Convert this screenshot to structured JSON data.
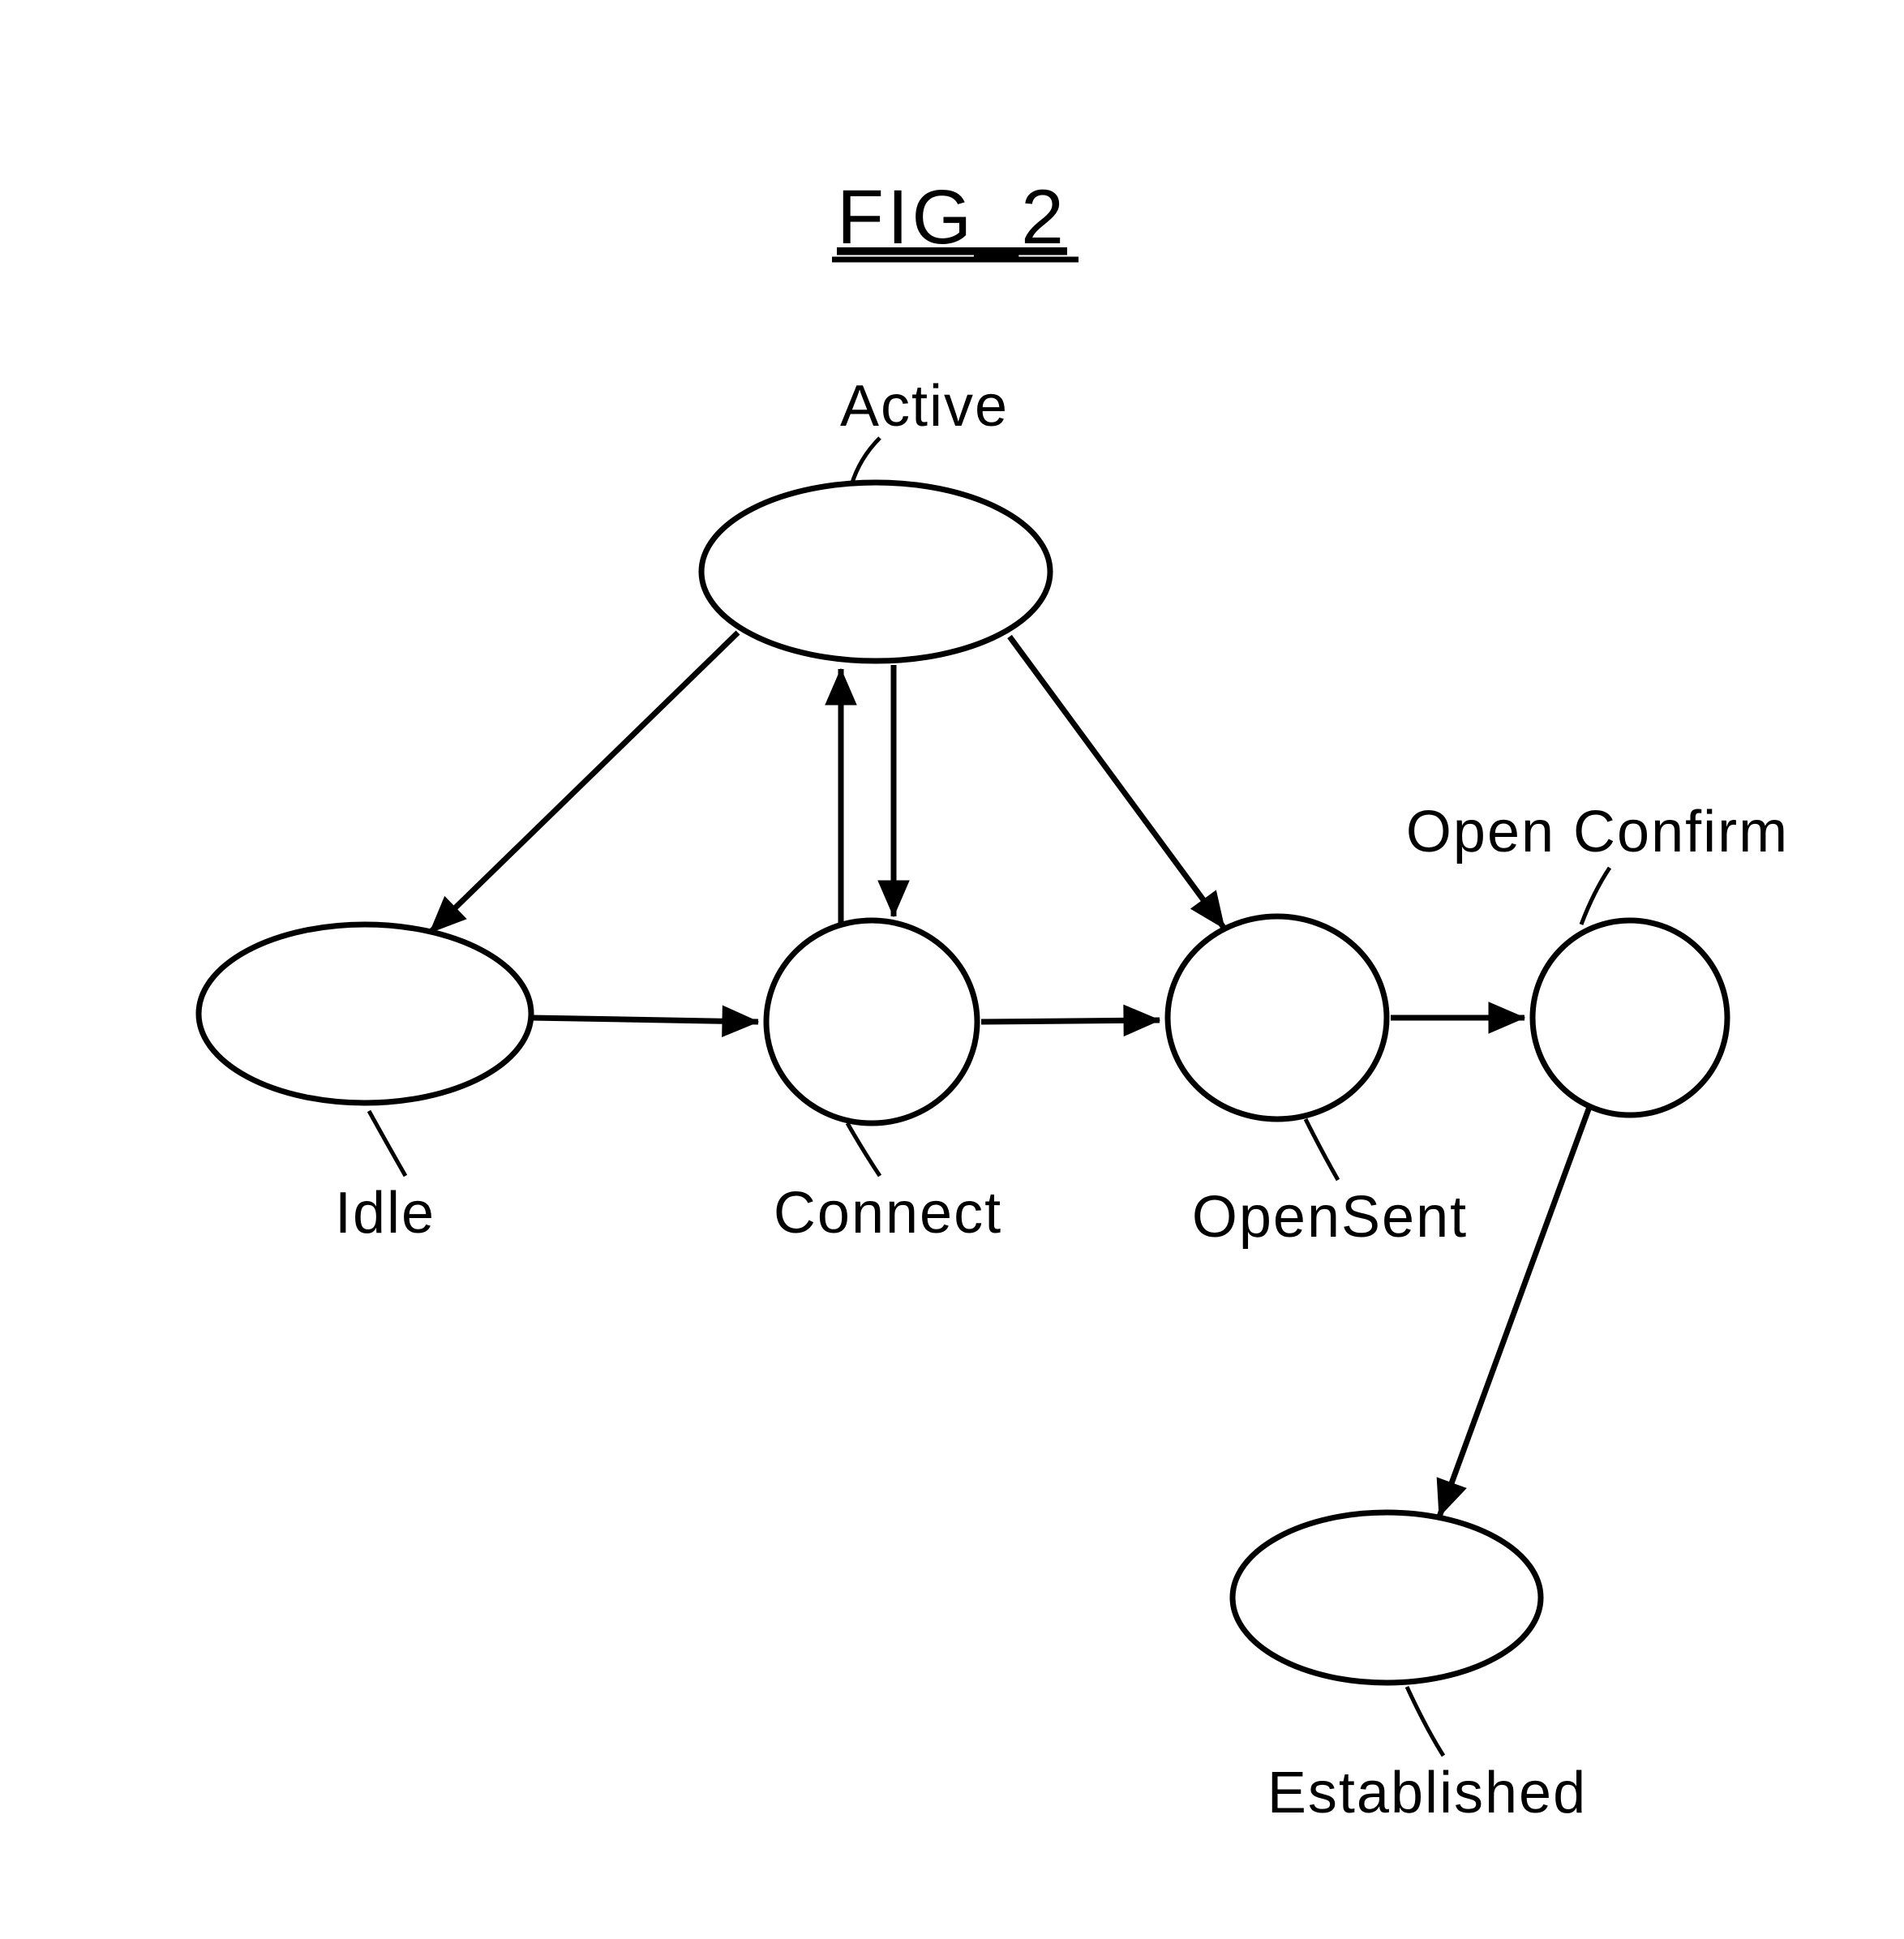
{
  "figure": {
    "title": "FIG_2",
    "nodes": {
      "active": {
        "label": "Active"
      },
      "idle": {
        "label": "Idle"
      },
      "connect": {
        "label": "Connect"
      },
      "opensent": {
        "label": "OpenSent"
      },
      "openconfirm": {
        "label": "Open Confirm"
      },
      "established": {
        "label": "Established"
      }
    }
  }
}
